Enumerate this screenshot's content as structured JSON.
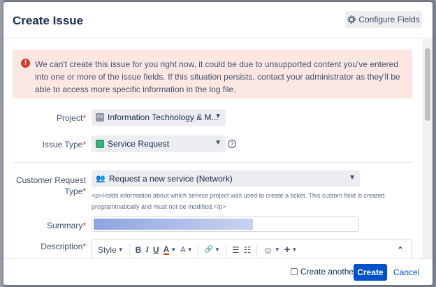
{
  "dialog": {
    "title": "Create Issue",
    "configure_fields_label": "Configure Fields"
  },
  "error": {
    "message": "We can't create this issue for you right now, it could be due to unsupported content you've entered into one or more of the issue fields. If this situation persists, contact your administrator as they'll be able to access more specific information in the log file."
  },
  "fields": {
    "project": {
      "label": "Project",
      "value": "Information Technology & M..."
    },
    "issue_type": {
      "label": "Issue Type",
      "value": "Service Request"
    },
    "customer_request_type": {
      "label": "Customer Request Type",
      "value": "Request a new service (Network)",
      "description": "<p>Holds information about which service project was used to create a ticket. This custom field is created programmatically and must not be modified.</p>"
    },
    "summary": {
      "label": "Summary",
      "value": ""
    },
    "description": {
      "label": "Description"
    }
  },
  "editor_toolbar": {
    "style_label": "Style",
    "bold": "B",
    "italic": "I",
    "underline": "U",
    "text_color": "A",
    "more_format": "A",
    "link": "🔗",
    "bullet_list": "☰",
    "numbered_list": "☷",
    "emoji": "☺",
    "insert": "+",
    "collapse": "⌃"
  },
  "required_marker": "*",
  "footer": {
    "create_another_label": "Create another",
    "create_another_checked": false,
    "create_label": "Create",
    "cancel_label": "Cancel"
  },
  "colors": {
    "primary": "#0052cc",
    "error_bg": "#fde7e2",
    "error_icon": "#d5392a",
    "required": "#de350b"
  }
}
